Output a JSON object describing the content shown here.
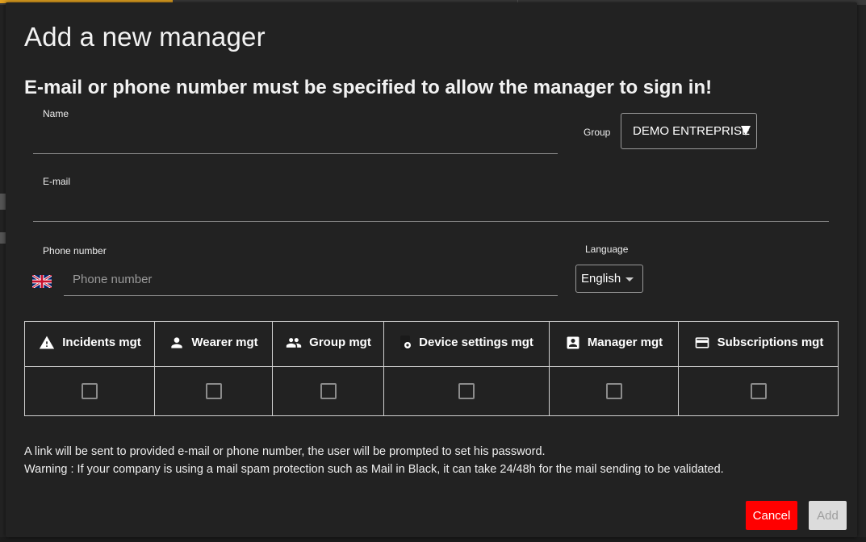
{
  "dialog": {
    "title": "Add a new manager",
    "subtitle": "E-mail or phone number must be specified to allow the manager to sign in!"
  },
  "form": {
    "name": {
      "label": "Name",
      "value": ""
    },
    "group": {
      "label": "Group",
      "value": "DEMO ENTREPRISE"
    },
    "email": {
      "label": "E-mail",
      "value": ""
    },
    "phone": {
      "label": "Phone number",
      "placeholder": "Phone number",
      "value": "",
      "country_flag": "uk-flag-icon"
    },
    "language": {
      "label": "Language",
      "value": "English"
    }
  },
  "permissions": {
    "columns": [
      {
        "label": "Incidents mgt",
        "icon": "warning-icon",
        "checked": false
      },
      {
        "label": "Wearer mgt",
        "icon": "person-icon",
        "checked": false
      },
      {
        "label": "Group mgt",
        "icon": "people-icon",
        "checked": false
      },
      {
        "label": "Device settings mgt",
        "icon": "phone-settings-icon",
        "checked": false
      },
      {
        "label": "Manager mgt",
        "icon": "account-box-icon",
        "checked": false
      },
      {
        "label": "Subscriptions mgt",
        "icon": "credit-card-icon",
        "checked": false
      }
    ]
  },
  "info": {
    "line1": "A link will be sent to provided e-mail or phone number, the user will be prompted to set his password.",
    "line2": "Warning : If your company is using a mail spam protection such as Mail in Black, it can take 24/48h for the mail sending to be validated."
  },
  "actions": {
    "cancel_label": "Cancel",
    "add_label": "Add",
    "cancel_color": "#ff0000"
  }
}
